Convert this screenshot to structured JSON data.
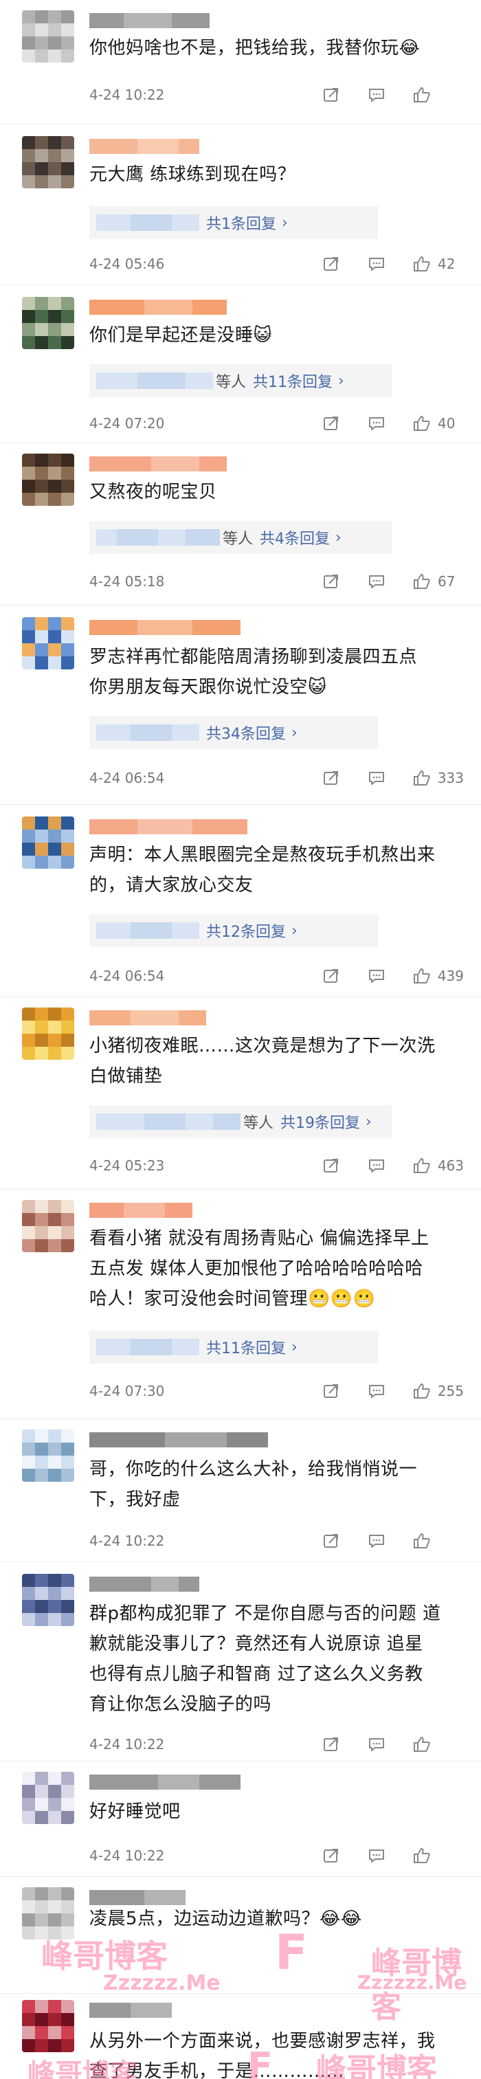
{
  "colors": {
    "link": "#4a6aa8",
    "muted": "#777777",
    "reply_bg": "#f4f4f4",
    "text": "#1b1b1b",
    "watermark": "#ff78a0"
  },
  "comments": [
    {
      "text": "你他妈啥也不是，把钱给我，我替你玩😂",
      "time": "4-24 10:22",
      "likes": ""
    },
    {
      "text": "元大鹰 练球练到现在吗？",
      "reply_label": "共1条回复",
      "reply_chevron": "›",
      "time": "4-24 05:46",
      "likes": "42"
    },
    {
      "text": "你们是早起还是没睡😺",
      "reply_deng": "等人",
      "reply_label": "共11条回复",
      "reply_chevron": "›",
      "time": "4-24 07:20",
      "likes": "40"
    },
    {
      "text": "又熬夜的呢宝贝",
      "reply_deng": "等人",
      "reply_label": "共4条回复",
      "reply_chevron": "›",
      "time": "4-24 05:18",
      "likes": "67"
    },
    {
      "text": "罗志祥再忙都能陪周清扬聊到凌晨四五点\n你男朋友每天跟你说忙没空😺",
      "reply_label": "共34条回复",
      "reply_chevron": "›",
      "time": "4-24 06:54",
      "likes": "333"
    },
    {
      "text": "声明：本人黑眼圈完全是熬夜玩手机熬出来\n的，请大家放心交友",
      "reply_label": "共12条回复",
      "reply_chevron": "›",
      "time": "4-24 06:54",
      "likes": "439"
    },
    {
      "text": "小猪彻夜难眠……这次竟是想为了下一次洗\n白做铺垫",
      "reply_deng": "等人",
      "reply_label": "共19条回复",
      "reply_chevron": "›",
      "time": "4-24 05:23",
      "likes": "463"
    },
    {
      "text": "看看小猪 就没有周扬青贴心 偏偏选择早上\n五点发 媒体人更加恨他了哈哈哈哈哈哈哈\n哈人！家可没他会时间管理😬😬😬",
      "reply_label": "共11条回复",
      "reply_chevron": "›",
      "time": "4-24 07:30",
      "likes": "255"
    },
    {
      "text": "哥，你吃的什么这么大补，给我悄悄说一\n下，我好虚",
      "time": "4-24 10:22",
      "likes": ""
    },
    {
      "text": "群p都构成犯罪了 不是你自愿与否的问题 道\n歉就能没事儿了？竟然还有人说原谅 追星\n也得有点儿脑子和智商 过了这么久义务教\n育让你怎么没脑子的吗",
      "time": "4-24 10:22",
      "likes": ""
    },
    {
      "text": "好好睡觉吧",
      "time": "4-24 10:22",
      "likes": ""
    },
    {
      "text": "凌晨5点，边运动边道歉吗？😂😂",
      "time": "",
      "likes": ""
    },
    {
      "text": "从另外一个方面来说，也要感谢罗志祥，我\n查了男友手机，于是……………",
      "time": "",
      "likes": ""
    }
  ],
  "watermark": {
    "text_cn": "峰哥博客",
    "text_url": "Zzzzzz.Me",
    "letter": "F"
  }
}
